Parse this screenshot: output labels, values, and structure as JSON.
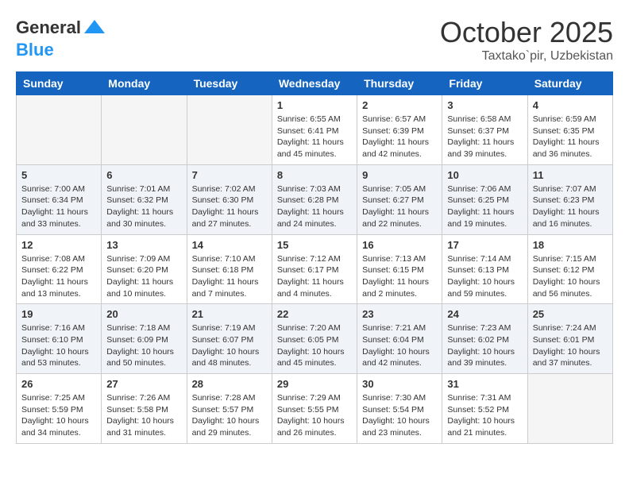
{
  "header": {
    "logo": {
      "general": "General",
      "blue": "Blue"
    },
    "title": "October 2025",
    "subtitle": "Taxtako`pir, Uzbekistan"
  },
  "weekdays": [
    "Sunday",
    "Monday",
    "Tuesday",
    "Wednesday",
    "Thursday",
    "Friday",
    "Saturday"
  ],
  "weeks": [
    [
      {
        "day": "",
        "sunrise": "",
        "sunset": "",
        "daylight": ""
      },
      {
        "day": "",
        "sunrise": "",
        "sunset": "",
        "daylight": ""
      },
      {
        "day": "",
        "sunrise": "",
        "sunset": "",
        "daylight": ""
      },
      {
        "day": "1",
        "sunrise": "Sunrise: 6:55 AM",
        "sunset": "Sunset: 6:41 PM",
        "daylight": "Daylight: 11 hours and 45 minutes."
      },
      {
        "day": "2",
        "sunrise": "Sunrise: 6:57 AM",
        "sunset": "Sunset: 6:39 PM",
        "daylight": "Daylight: 11 hours and 42 minutes."
      },
      {
        "day": "3",
        "sunrise": "Sunrise: 6:58 AM",
        "sunset": "Sunset: 6:37 PM",
        "daylight": "Daylight: 11 hours and 39 minutes."
      },
      {
        "day": "4",
        "sunrise": "Sunrise: 6:59 AM",
        "sunset": "Sunset: 6:35 PM",
        "daylight": "Daylight: 11 hours and 36 minutes."
      }
    ],
    [
      {
        "day": "5",
        "sunrise": "Sunrise: 7:00 AM",
        "sunset": "Sunset: 6:34 PM",
        "daylight": "Daylight: 11 hours and 33 minutes."
      },
      {
        "day": "6",
        "sunrise": "Sunrise: 7:01 AM",
        "sunset": "Sunset: 6:32 PM",
        "daylight": "Daylight: 11 hours and 30 minutes."
      },
      {
        "day": "7",
        "sunrise": "Sunrise: 7:02 AM",
        "sunset": "Sunset: 6:30 PM",
        "daylight": "Daylight: 11 hours and 27 minutes."
      },
      {
        "day": "8",
        "sunrise": "Sunrise: 7:03 AM",
        "sunset": "Sunset: 6:28 PM",
        "daylight": "Daylight: 11 hours and 24 minutes."
      },
      {
        "day": "9",
        "sunrise": "Sunrise: 7:05 AM",
        "sunset": "Sunset: 6:27 PM",
        "daylight": "Daylight: 11 hours and 22 minutes."
      },
      {
        "day": "10",
        "sunrise": "Sunrise: 7:06 AM",
        "sunset": "Sunset: 6:25 PM",
        "daylight": "Daylight: 11 hours and 19 minutes."
      },
      {
        "day": "11",
        "sunrise": "Sunrise: 7:07 AM",
        "sunset": "Sunset: 6:23 PM",
        "daylight": "Daylight: 11 hours and 16 minutes."
      }
    ],
    [
      {
        "day": "12",
        "sunrise": "Sunrise: 7:08 AM",
        "sunset": "Sunset: 6:22 PM",
        "daylight": "Daylight: 11 hours and 13 minutes."
      },
      {
        "day": "13",
        "sunrise": "Sunrise: 7:09 AM",
        "sunset": "Sunset: 6:20 PM",
        "daylight": "Daylight: 11 hours and 10 minutes."
      },
      {
        "day": "14",
        "sunrise": "Sunrise: 7:10 AM",
        "sunset": "Sunset: 6:18 PM",
        "daylight": "Daylight: 11 hours and 7 minutes."
      },
      {
        "day": "15",
        "sunrise": "Sunrise: 7:12 AM",
        "sunset": "Sunset: 6:17 PM",
        "daylight": "Daylight: 11 hours and 4 minutes."
      },
      {
        "day": "16",
        "sunrise": "Sunrise: 7:13 AM",
        "sunset": "Sunset: 6:15 PM",
        "daylight": "Daylight: 11 hours and 2 minutes."
      },
      {
        "day": "17",
        "sunrise": "Sunrise: 7:14 AM",
        "sunset": "Sunset: 6:13 PM",
        "daylight": "Daylight: 10 hours and 59 minutes."
      },
      {
        "day": "18",
        "sunrise": "Sunrise: 7:15 AM",
        "sunset": "Sunset: 6:12 PM",
        "daylight": "Daylight: 10 hours and 56 minutes."
      }
    ],
    [
      {
        "day": "19",
        "sunrise": "Sunrise: 7:16 AM",
        "sunset": "Sunset: 6:10 PM",
        "daylight": "Daylight: 10 hours and 53 minutes."
      },
      {
        "day": "20",
        "sunrise": "Sunrise: 7:18 AM",
        "sunset": "Sunset: 6:09 PM",
        "daylight": "Daylight: 10 hours and 50 minutes."
      },
      {
        "day": "21",
        "sunrise": "Sunrise: 7:19 AM",
        "sunset": "Sunset: 6:07 PM",
        "daylight": "Daylight: 10 hours and 48 minutes."
      },
      {
        "day": "22",
        "sunrise": "Sunrise: 7:20 AM",
        "sunset": "Sunset: 6:05 PM",
        "daylight": "Daylight: 10 hours and 45 minutes."
      },
      {
        "day": "23",
        "sunrise": "Sunrise: 7:21 AM",
        "sunset": "Sunset: 6:04 PM",
        "daylight": "Daylight: 10 hours and 42 minutes."
      },
      {
        "day": "24",
        "sunrise": "Sunrise: 7:23 AM",
        "sunset": "Sunset: 6:02 PM",
        "daylight": "Daylight: 10 hours and 39 minutes."
      },
      {
        "day": "25",
        "sunrise": "Sunrise: 7:24 AM",
        "sunset": "Sunset: 6:01 PM",
        "daylight": "Daylight: 10 hours and 37 minutes."
      }
    ],
    [
      {
        "day": "26",
        "sunrise": "Sunrise: 7:25 AM",
        "sunset": "Sunset: 5:59 PM",
        "daylight": "Daylight: 10 hours and 34 minutes."
      },
      {
        "day": "27",
        "sunrise": "Sunrise: 7:26 AM",
        "sunset": "Sunset: 5:58 PM",
        "daylight": "Daylight: 10 hours and 31 minutes."
      },
      {
        "day": "28",
        "sunrise": "Sunrise: 7:28 AM",
        "sunset": "Sunset: 5:57 PM",
        "daylight": "Daylight: 10 hours and 29 minutes."
      },
      {
        "day": "29",
        "sunrise": "Sunrise: 7:29 AM",
        "sunset": "Sunset: 5:55 PM",
        "daylight": "Daylight: 10 hours and 26 minutes."
      },
      {
        "day": "30",
        "sunrise": "Sunrise: 7:30 AM",
        "sunset": "Sunset: 5:54 PM",
        "daylight": "Daylight: 10 hours and 23 minutes."
      },
      {
        "day": "31",
        "sunrise": "Sunrise: 7:31 AM",
        "sunset": "Sunset: 5:52 PM",
        "daylight": "Daylight: 10 hours and 21 minutes."
      },
      {
        "day": "",
        "sunrise": "",
        "sunset": "",
        "daylight": ""
      }
    ]
  ]
}
